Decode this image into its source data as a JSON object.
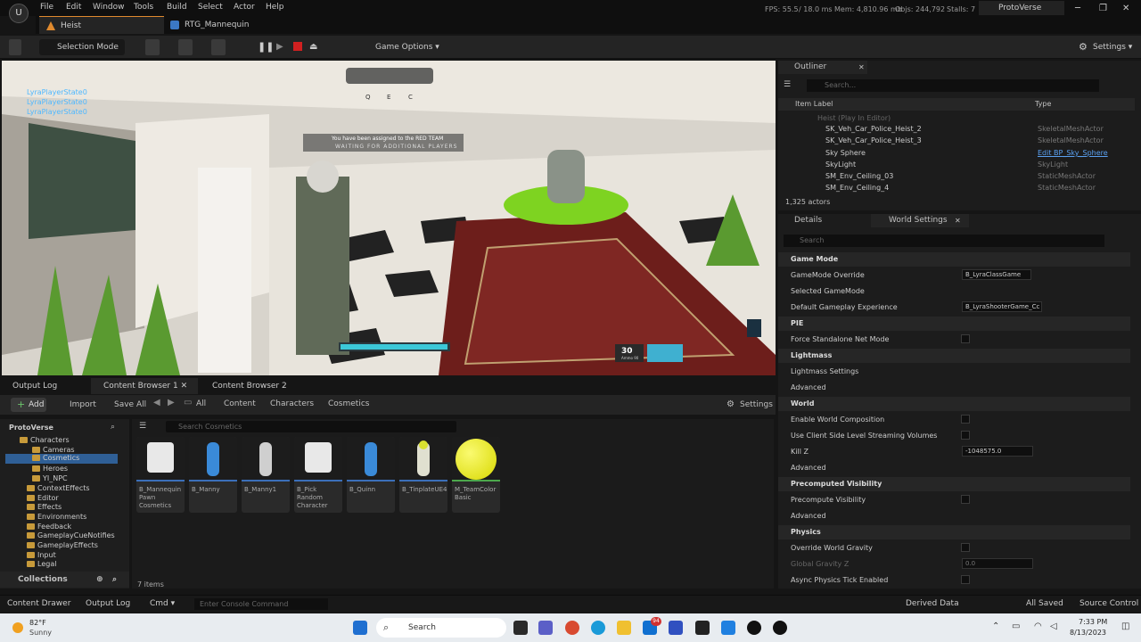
{
  "menubar": {
    "items": [
      "File",
      "Edit",
      "Window",
      "Tools",
      "Build",
      "Select",
      "Actor",
      "Help"
    ],
    "fps": "FPS: 55.5",
    "frame_ms": "/ 18.0 ms",
    "mem": "Mem: 4,810.96 mb",
    "objs": "Objs: 244,792",
    "stalls": "Stalls: 7",
    "project": "ProtoVerse"
  },
  "tabs": [
    {
      "label": "Heist"
    },
    {
      "label": "RTG_Mannequin"
    }
  ],
  "toolbar": {
    "selection_mode": "Selection Mode",
    "game_options": "Game Options",
    "settings": "Settings"
  },
  "viewport": {
    "player_labels": [
      "LyraPlayerState0",
      "LyraPlayerState0",
      "LyraPlayerState0"
    ],
    "assigned_msg": "You have been assigned to the RED TEAM",
    "waiting_msg": "WAITING FOR ADDITIONAL PLAYERS",
    "ammo": "30",
    "ammo_sub": "Ammo 90",
    "ability_keys": [
      "Q",
      "E",
      "C"
    ]
  },
  "bottom_tabs": [
    "Output Log",
    "Content Browser 1",
    "Content Browser 2"
  ],
  "content_browser": {
    "add": "Add",
    "import": "Import",
    "save_all": "Save All",
    "breadcrumb": [
      "All",
      "Content",
      "Characters",
      "Cosmetics"
    ],
    "settings": "Settings",
    "search_placeholder": "Search Cosmetics",
    "root": "ProtoVerse",
    "tree": [
      "Characters",
      "Cameras",
      "Cosmetics",
      "Heroes",
      "YI_NPC",
      "ContextEffects",
      "Editor",
      "Effects",
      "Environments",
      "Feedback",
      "GameplayCueNotifies",
      "GameplayEffects",
      "Input",
      "Legal"
    ],
    "collections": "Collections",
    "item_count": "7 items",
    "assets": [
      {
        "name": "B_Mannequin Pawn Cosmetics"
      },
      {
        "name": "B_Manny"
      },
      {
        "name": "B_Manny1"
      },
      {
        "name": "B_Pick Random Character"
      },
      {
        "name": "B_Quinn"
      },
      {
        "name": "B_TinplateUE4"
      },
      {
        "name": "M_TeamColor Basic"
      }
    ]
  },
  "statusbar": {
    "content_drawer": "Content Drawer",
    "output_log": "Output Log",
    "cmd": "Cmd",
    "console_placeholder": "Enter Console Command",
    "derived_data": "Derived Data",
    "all_saved": "All Saved",
    "source_control": "Source Control"
  },
  "outliner": {
    "title": "Outliner",
    "search_placeholder": "Search...",
    "col_label": "Item Label",
    "col_type": "Type",
    "rows": [
      {
        "name": "Heist (Play In Editor)",
        "type": ""
      },
      {
        "name": "SK_Veh_Car_Police_Heist_2",
        "type": "SkeletalMeshActor"
      },
      {
        "name": "SK_Veh_Car_Police_Heist_3",
        "type": "SkeletalMeshActor"
      },
      {
        "name": "Sky Sphere",
        "type": "Edit BP_Sky_Sphere"
      },
      {
        "name": "SkyLight",
        "type": "SkyLight"
      },
      {
        "name": "SM_Env_Ceiling_03",
        "type": "StaticMeshActor"
      },
      {
        "name": "SM_Env_Ceiling_4",
        "type": "StaticMeshActor"
      }
    ],
    "count": "1,325 actors"
  },
  "details": {
    "tab_details": "Details",
    "tab_world": "World Settings",
    "search_placeholder": "Search",
    "game_mode": "Game Mode",
    "gamemode_override": "GameMode Override",
    "gamemode_value": "B_LyraClassGame",
    "selected_gamemode": "Selected GameMode",
    "default_exp": "Default Gameplay Experience",
    "default_exp_value": "B_LyraShooterGame_Cc",
    "pie": "PIE",
    "force_standalone": "Force Standalone Net Mode",
    "lightmass": "Lightmass",
    "lightmass_settings": "Lightmass Settings",
    "advanced": "Advanced",
    "world": "World",
    "enable_wc": "Enable World Composition",
    "use_client": "Use Client Side Level Streaming Volumes",
    "kill_z": "Kill Z",
    "kill_z_value": "-1048575.0",
    "precomputed": "Precomputed Visibility",
    "precompute_vis": "Precompute Visibility",
    "physics": "Physics",
    "override_gravity": "Override World Gravity",
    "global_gravity": "Global Gravity Z",
    "global_gravity_value": "0.0",
    "async_physics": "Async Physics Tick Enabled"
  },
  "taskbar": {
    "temp": "82°F",
    "weather": "Sunny",
    "search": "Search",
    "time": "7:33 PM",
    "date": "8/13/2023",
    "badge": "94"
  }
}
